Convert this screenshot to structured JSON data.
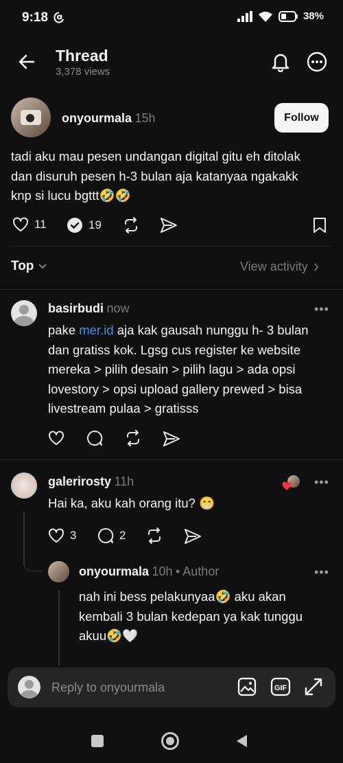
{
  "status_bar": {
    "time": "9:18",
    "battery": "38%"
  },
  "header": {
    "title": "Thread",
    "views": "3,378 views"
  },
  "main_post": {
    "username": "onyourmala",
    "time": "15h",
    "follow_label": "Follow",
    "text": "tadi aku mau pesen undangan digital gitu eh ditolak dan disuruh pesen h-3 bulan aja katanyaa ngakakk knp si lucu bgttt🤣🤣",
    "likes": "11",
    "reposts": "19"
  },
  "sort": {
    "label": "Top",
    "view_activity": "View activity"
  },
  "replies": [
    {
      "username": "basirbudi",
      "time": "now",
      "text_prefix": "pake ",
      "text_link": "mer.id",
      "text_rest": "  aja kak gausah nunggu h- 3 bulan dan gratiss kok. Lgsg cus register ke website mereka > pilih desain > pilih lagu > ada opsi lovestory > opsi upload gallery prewed > bisa livestream pulaa > gratisss"
    },
    {
      "username": "galerirosty",
      "time": "11h",
      "text": "Hai ka, aku kah orang itu? 😁",
      "likes": "3",
      "comments": "2"
    },
    {
      "username": "onyourmala",
      "time": "10h",
      "author_tag": "• Author",
      "text": "nah ini bess pelakunyaa🤣 aku akan kembali 3 bulan kedepan ya kak tunggu akuu🤣🤍"
    }
  ],
  "reply_bar": {
    "placeholder": "Reply to onyourmala"
  },
  "colors": {
    "background": "#101010",
    "link": "#3897f0",
    "muted": "#7a7a7a"
  }
}
